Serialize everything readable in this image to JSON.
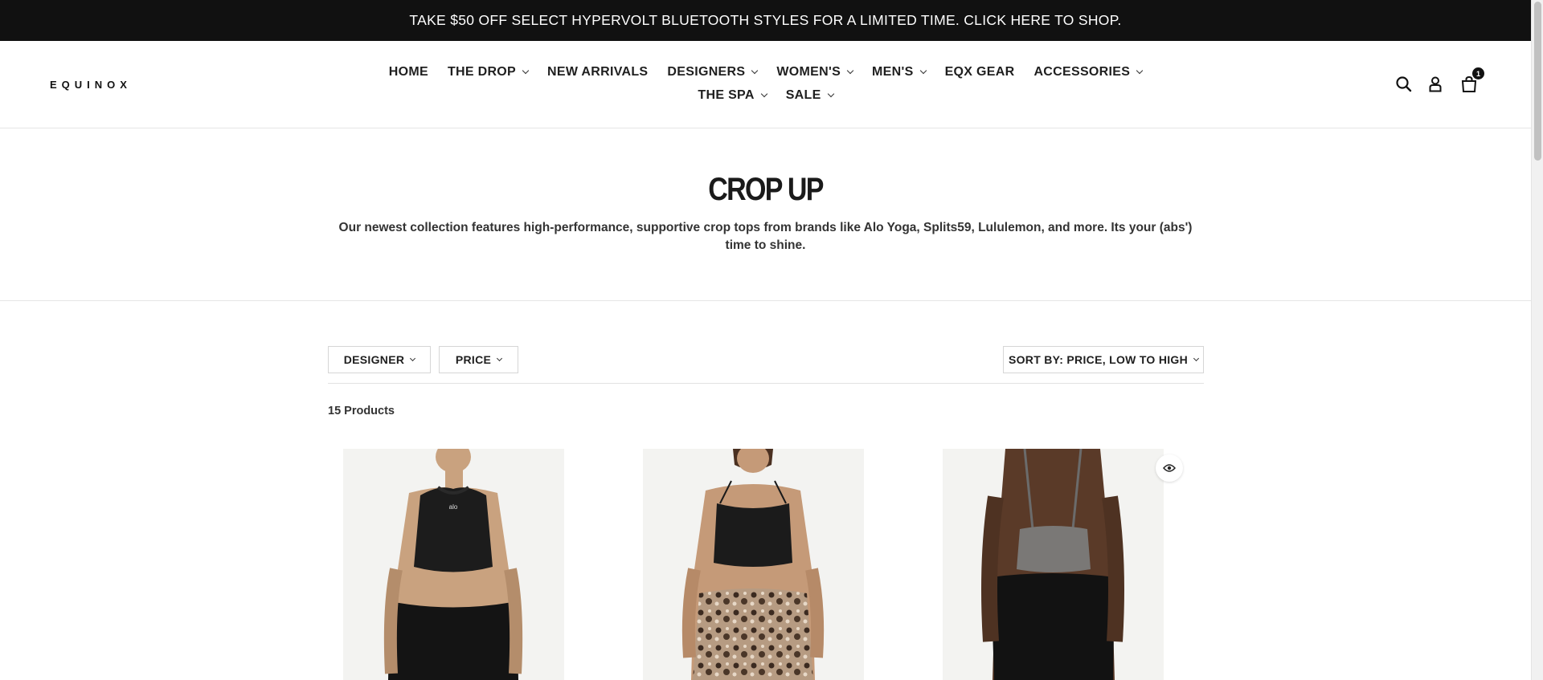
{
  "announcement": {
    "text": "TAKE $50 OFF SELECT HYPERVOLT BLUETOOTH STYLES FOR A LIMITED TIME. CLICK HERE TO SHOP."
  },
  "header": {
    "logo": "EQUINOX",
    "nav_row1": [
      {
        "label": "HOME",
        "dropdown": false
      },
      {
        "label": "THE DROP",
        "dropdown": true
      },
      {
        "label": "NEW ARRIVALS",
        "dropdown": false
      },
      {
        "label": "DESIGNERS",
        "dropdown": true
      },
      {
        "label": "WOMEN'S",
        "dropdown": true
      },
      {
        "label": "MEN'S",
        "dropdown": true
      },
      {
        "label": "EQX GEAR",
        "dropdown": false
      },
      {
        "label": "ACCESSORIES",
        "dropdown": true
      }
    ],
    "nav_row2": [
      {
        "label": "THE SPA",
        "dropdown": true
      },
      {
        "label": "SALE",
        "dropdown": true
      }
    ],
    "icons": [
      "search-icon",
      "account-icon",
      "cart-icon"
    ],
    "cart_count": "1"
  },
  "collection": {
    "title": "CROP UP",
    "description": "Our newest collection features high-performance, supportive crop tops from brands like Alo Yoga, Splits59, Lululemon, and more. Its your (abs') time to shine."
  },
  "filters": {
    "designer_label": "DESIGNER",
    "price_label": "PRICE",
    "sort_label": "SORT BY: PRICE, LOW TO HIGH"
  },
  "product_count": "15 Products",
  "products": [
    {
      "image": "black-racerback-crop-top-alo",
      "brand_mark": "alo"
    },
    {
      "image": "black-cami-crop-top-leopard-leggings"
    },
    {
      "image": "grey-strappy-crop-top-back-view",
      "quickview_icon": "eye-icon"
    }
  ],
  "colors": {
    "announcement_bg": "#111111",
    "text": "#1a1a1a",
    "border": "#d6d6d6"
  }
}
